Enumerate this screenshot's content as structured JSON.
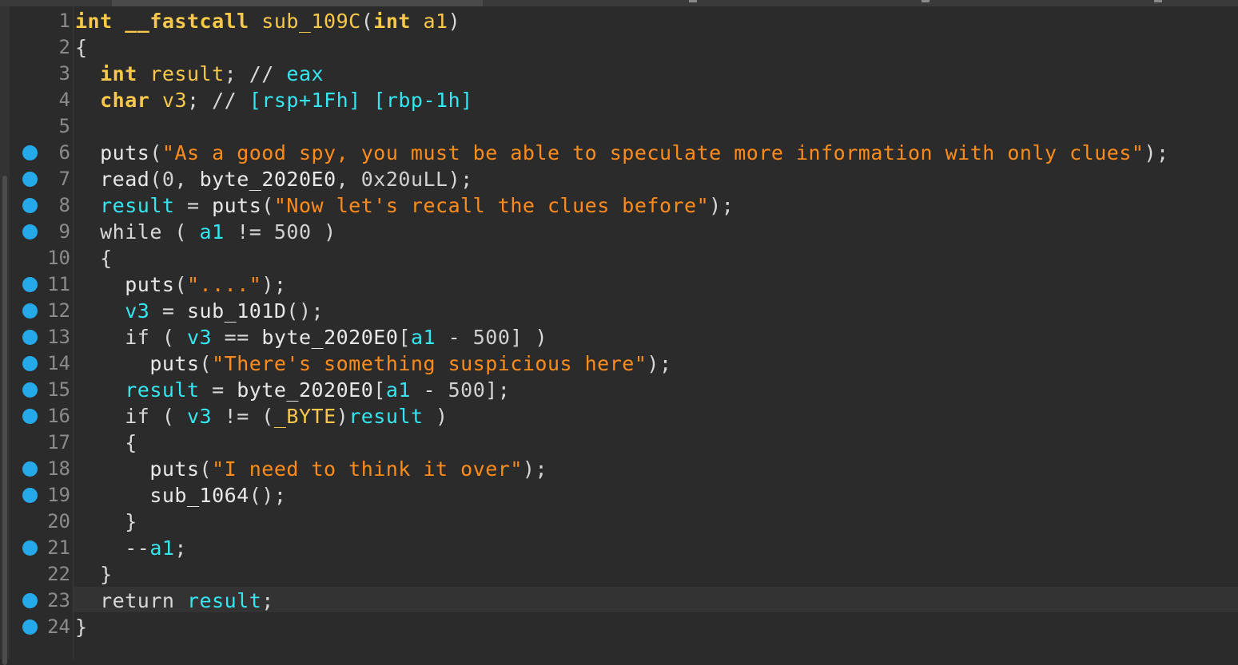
{
  "editor": {
    "current_line": 23,
    "breakpoint_color": "#25a9e8",
    "lines": [
      {
        "n": "1",
        "bp": false,
        "tokens": [
          [
            "k",
            "int"
          ],
          [
            "p",
            " "
          ],
          [
            "k",
            "__fastcall"
          ],
          [
            "p",
            " "
          ],
          [
            "t",
            "sub_109C"
          ],
          [
            "p",
            "("
          ],
          [
            "k",
            "int"
          ],
          [
            "p",
            " "
          ],
          [
            "t",
            "a1"
          ],
          [
            "p",
            ")"
          ]
        ]
      },
      {
        "n": "2",
        "bp": false,
        "tokens": [
          [
            "p",
            "{"
          ]
        ]
      },
      {
        "n": "3",
        "bp": false,
        "tokens": [
          [
            "p",
            "  "
          ],
          [
            "k",
            "int"
          ],
          [
            "p",
            " "
          ],
          [
            "t",
            "result"
          ],
          [
            "p",
            "; // "
          ],
          [
            "c",
            "eax"
          ]
        ]
      },
      {
        "n": "4",
        "bp": false,
        "tokens": [
          [
            "p",
            "  "
          ],
          [
            "k",
            "char"
          ],
          [
            "p",
            " "
          ],
          [
            "t",
            "v3"
          ],
          [
            "p",
            "; // "
          ],
          [
            "c",
            "[rsp+1Fh] [rbp-1h]"
          ]
        ]
      },
      {
        "n": "5",
        "bp": false,
        "tokens": []
      },
      {
        "n": "6",
        "bp": true,
        "tokens": [
          [
            "p",
            "  "
          ],
          [
            "fn",
            "puts"
          ],
          [
            "p",
            "("
          ],
          [
            "s",
            "\"As a good spy, you must be able to speculate more information with only clues\""
          ],
          [
            "p",
            ");"
          ]
        ]
      },
      {
        "n": "7",
        "bp": true,
        "tokens": [
          [
            "p",
            "  "
          ],
          [
            "fn",
            "read"
          ],
          [
            "p",
            "("
          ],
          [
            "n",
            "0"
          ],
          [
            "p",
            ", "
          ],
          [
            "fn",
            "byte_2020E0"
          ],
          [
            "p",
            ", "
          ],
          [
            "n",
            "0x20uLL"
          ],
          [
            "p",
            ");"
          ]
        ]
      },
      {
        "n": "8",
        "bp": true,
        "tokens": [
          [
            "p",
            "  "
          ],
          [
            "id",
            "result"
          ],
          [
            "p",
            " = "
          ],
          [
            "fn",
            "puts"
          ],
          [
            "p",
            "("
          ],
          [
            "s",
            "\"Now let's recall the clues before\""
          ],
          [
            "p",
            ");"
          ]
        ]
      },
      {
        "n": "9",
        "bp": true,
        "tokens": [
          [
            "p",
            "  "
          ],
          [
            "p",
            "while"
          ],
          [
            "p",
            " ( "
          ],
          [
            "id",
            "a1"
          ],
          [
            "p",
            " != "
          ],
          [
            "n",
            "500"
          ],
          [
            "p",
            " )"
          ]
        ]
      },
      {
        "n": "10",
        "bp": false,
        "tokens": [
          [
            "p",
            "  {"
          ]
        ]
      },
      {
        "n": "11",
        "bp": true,
        "tokens": [
          [
            "p",
            "    "
          ],
          [
            "fn",
            "puts"
          ],
          [
            "p",
            "("
          ],
          [
            "s",
            "\"....\""
          ],
          [
            "p",
            ");"
          ]
        ]
      },
      {
        "n": "12",
        "bp": true,
        "tokens": [
          [
            "p",
            "    "
          ],
          [
            "id",
            "v3"
          ],
          [
            "p",
            " = "
          ],
          [
            "fn",
            "sub_101D"
          ],
          [
            "p",
            "();"
          ]
        ]
      },
      {
        "n": "13",
        "bp": true,
        "tokens": [
          [
            "p",
            "    "
          ],
          [
            "p",
            "if"
          ],
          [
            "p",
            " ( "
          ],
          [
            "id",
            "v3"
          ],
          [
            "p",
            " == "
          ],
          [
            "fn",
            "byte_2020E0"
          ],
          [
            "p",
            "["
          ],
          [
            "id",
            "a1"
          ],
          [
            "p",
            " - "
          ],
          [
            "n",
            "500"
          ],
          [
            "p",
            "] )"
          ]
        ]
      },
      {
        "n": "14",
        "bp": true,
        "tokens": [
          [
            "p",
            "      "
          ],
          [
            "fn",
            "puts"
          ],
          [
            "p",
            "("
          ],
          [
            "s",
            "\"There's something suspicious here\""
          ],
          [
            "p",
            ");"
          ]
        ]
      },
      {
        "n": "15",
        "bp": true,
        "tokens": [
          [
            "p",
            "    "
          ],
          [
            "id",
            "result"
          ],
          [
            "p",
            " = "
          ],
          [
            "fn",
            "byte_2020E0"
          ],
          [
            "p",
            "["
          ],
          [
            "id",
            "a1"
          ],
          [
            "p",
            " - "
          ],
          [
            "n",
            "500"
          ],
          [
            "p",
            "];"
          ]
        ]
      },
      {
        "n": "16",
        "bp": true,
        "tokens": [
          [
            "p",
            "    "
          ],
          [
            "p",
            "if"
          ],
          [
            "p",
            " ( "
          ],
          [
            "id",
            "v3"
          ],
          [
            "p",
            " != ("
          ],
          [
            "t",
            "_BYTE"
          ],
          [
            "p",
            ")"
          ],
          [
            "id",
            "result"
          ],
          [
            "p",
            " )"
          ]
        ]
      },
      {
        "n": "17",
        "bp": false,
        "tokens": [
          [
            "p",
            "    {"
          ]
        ]
      },
      {
        "n": "18",
        "bp": true,
        "tokens": [
          [
            "p",
            "      "
          ],
          [
            "fn",
            "puts"
          ],
          [
            "p",
            "("
          ],
          [
            "s",
            "\"I need to think it over\""
          ],
          [
            "p",
            ");"
          ]
        ]
      },
      {
        "n": "19",
        "bp": true,
        "tokens": [
          [
            "p",
            "      "
          ],
          [
            "fn",
            "sub_1064"
          ],
          [
            "p",
            "();"
          ]
        ]
      },
      {
        "n": "20",
        "bp": false,
        "tokens": [
          [
            "p",
            "    }"
          ]
        ]
      },
      {
        "n": "21",
        "bp": true,
        "tokens": [
          [
            "p",
            "    --"
          ],
          [
            "id",
            "a1"
          ],
          [
            "p",
            ";"
          ]
        ]
      },
      {
        "n": "22",
        "bp": false,
        "tokens": [
          [
            "p",
            "  }"
          ]
        ]
      },
      {
        "n": "23",
        "bp": true,
        "tokens": [
          [
            "p",
            "  "
          ],
          [
            "p",
            "return"
          ],
          [
            "p",
            " "
          ],
          [
            "id",
            "result"
          ],
          [
            "p",
            ";"
          ]
        ]
      },
      {
        "n": "24",
        "bp": true,
        "tokens": [
          [
            "p",
            "}"
          ]
        ]
      }
    ]
  }
}
